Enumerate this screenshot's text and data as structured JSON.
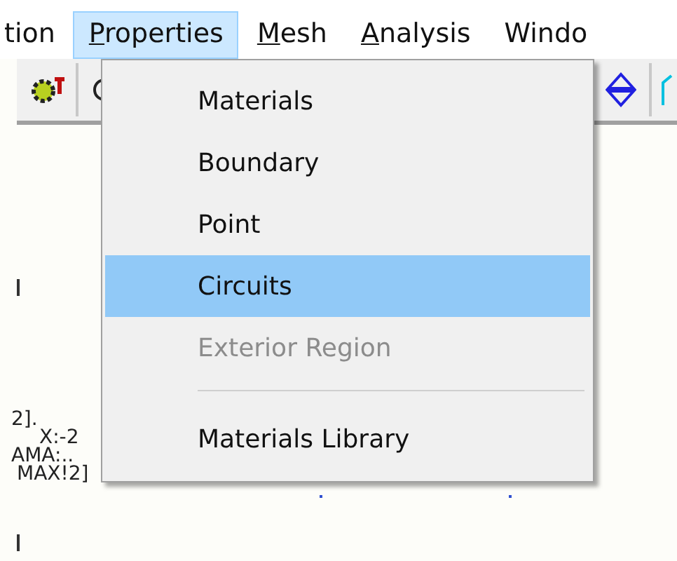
{
  "menu_bar": [
    {
      "label": "tion",
      "selected": false,
      "underline_first": false
    },
    {
      "label": "Properties",
      "selected": true,
      "underline_first": true
    },
    {
      "label": "Mesh",
      "selected": false,
      "underline_first": true
    },
    {
      "label": "Analysis",
      "selected": false,
      "underline_first": true
    },
    {
      "label": "Windo",
      "selected": false,
      "underline_first": false
    }
  ],
  "dropdown": [
    {
      "kind": "item",
      "label": "Materials",
      "selected": false,
      "disabled": false
    },
    {
      "kind": "item",
      "label": "Boundary",
      "selected": false,
      "disabled": false
    },
    {
      "kind": "item",
      "label": "Point",
      "selected": false,
      "disabled": false
    },
    {
      "kind": "item",
      "label": "Circuits",
      "selected": true,
      "disabled": false
    },
    {
      "kind": "item",
      "label": "Exterior Region",
      "selected": false,
      "disabled": true
    },
    {
      "kind": "separator"
    },
    {
      "kind": "item",
      "label": "Materials Library",
      "selected": false,
      "disabled": false
    }
  ],
  "canvas_labels": [
    "2].",
    "X:-2",
    "AMA:..",
    "MAX!2]"
  ]
}
